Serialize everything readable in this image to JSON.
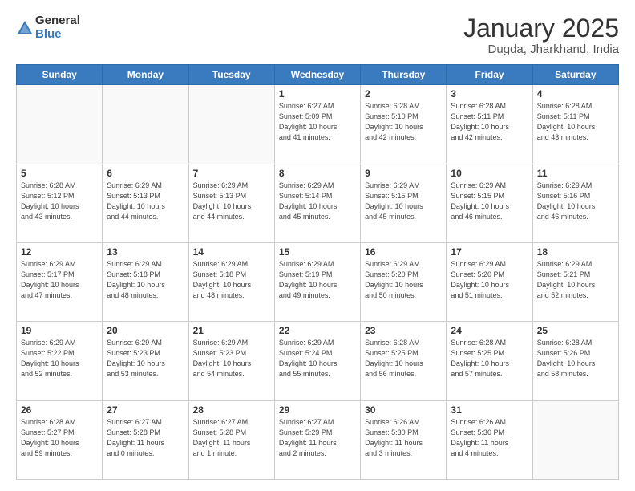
{
  "header": {
    "logo_general": "General",
    "logo_blue": "Blue",
    "month_title": "January 2025",
    "location": "Dugda, Jharkhand, India"
  },
  "days_of_week": [
    "Sunday",
    "Monday",
    "Tuesday",
    "Wednesday",
    "Thursday",
    "Friday",
    "Saturday"
  ],
  "weeks": [
    [
      {
        "day": "",
        "info": ""
      },
      {
        "day": "",
        "info": ""
      },
      {
        "day": "",
        "info": ""
      },
      {
        "day": "1",
        "info": "Sunrise: 6:27 AM\nSunset: 5:09 PM\nDaylight: 10 hours\nand 41 minutes."
      },
      {
        "day": "2",
        "info": "Sunrise: 6:28 AM\nSunset: 5:10 PM\nDaylight: 10 hours\nand 42 minutes."
      },
      {
        "day": "3",
        "info": "Sunrise: 6:28 AM\nSunset: 5:11 PM\nDaylight: 10 hours\nand 42 minutes."
      },
      {
        "day": "4",
        "info": "Sunrise: 6:28 AM\nSunset: 5:11 PM\nDaylight: 10 hours\nand 43 minutes."
      }
    ],
    [
      {
        "day": "5",
        "info": "Sunrise: 6:28 AM\nSunset: 5:12 PM\nDaylight: 10 hours\nand 43 minutes."
      },
      {
        "day": "6",
        "info": "Sunrise: 6:29 AM\nSunset: 5:13 PM\nDaylight: 10 hours\nand 44 minutes."
      },
      {
        "day": "7",
        "info": "Sunrise: 6:29 AM\nSunset: 5:13 PM\nDaylight: 10 hours\nand 44 minutes."
      },
      {
        "day": "8",
        "info": "Sunrise: 6:29 AM\nSunset: 5:14 PM\nDaylight: 10 hours\nand 45 minutes."
      },
      {
        "day": "9",
        "info": "Sunrise: 6:29 AM\nSunset: 5:15 PM\nDaylight: 10 hours\nand 45 minutes."
      },
      {
        "day": "10",
        "info": "Sunrise: 6:29 AM\nSunset: 5:15 PM\nDaylight: 10 hours\nand 46 minutes."
      },
      {
        "day": "11",
        "info": "Sunrise: 6:29 AM\nSunset: 5:16 PM\nDaylight: 10 hours\nand 46 minutes."
      }
    ],
    [
      {
        "day": "12",
        "info": "Sunrise: 6:29 AM\nSunset: 5:17 PM\nDaylight: 10 hours\nand 47 minutes."
      },
      {
        "day": "13",
        "info": "Sunrise: 6:29 AM\nSunset: 5:18 PM\nDaylight: 10 hours\nand 48 minutes."
      },
      {
        "day": "14",
        "info": "Sunrise: 6:29 AM\nSunset: 5:18 PM\nDaylight: 10 hours\nand 48 minutes."
      },
      {
        "day": "15",
        "info": "Sunrise: 6:29 AM\nSunset: 5:19 PM\nDaylight: 10 hours\nand 49 minutes."
      },
      {
        "day": "16",
        "info": "Sunrise: 6:29 AM\nSunset: 5:20 PM\nDaylight: 10 hours\nand 50 minutes."
      },
      {
        "day": "17",
        "info": "Sunrise: 6:29 AM\nSunset: 5:20 PM\nDaylight: 10 hours\nand 51 minutes."
      },
      {
        "day": "18",
        "info": "Sunrise: 6:29 AM\nSunset: 5:21 PM\nDaylight: 10 hours\nand 52 minutes."
      }
    ],
    [
      {
        "day": "19",
        "info": "Sunrise: 6:29 AM\nSunset: 5:22 PM\nDaylight: 10 hours\nand 52 minutes."
      },
      {
        "day": "20",
        "info": "Sunrise: 6:29 AM\nSunset: 5:23 PM\nDaylight: 10 hours\nand 53 minutes."
      },
      {
        "day": "21",
        "info": "Sunrise: 6:29 AM\nSunset: 5:23 PM\nDaylight: 10 hours\nand 54 minutes."
      },
      {
        "day": "22",
        "info": "Sunrise: 6:29 AM\nSunset: 5:24 PM\nDaylight: 10 hours\nand 55 minutes."
      },
      {
        "day": "23",
        "info": "Sunrise: 6:28 AM\nSunset: 5:25 PM\nDaylight: 10 hours\nand 56 minutes."
      },
      {
        "day": "24",
        "info": "Sunrise: 6:28 AM\nSunset: 5:25 PM\nDaylight: 10 hours\nand 57 minutes."
      },
      {
        "day": "25",
        "info": "Sunrise: 6:28 AM\nSunset: 5:26 PM\nDaylight: 10 hours\nand 58 minutes."
      }
    ],
    [
      {
        "day": "26",
        "info": "Sunrise: 6:28 AM\nSunset: 5:27 PM\nDaylight: 10 hours\nand 59 minutes."
      },
      {
        "day": "27",
        "info": "Sunrise: 6:27 AM\nSunset: 5:28 PM\nDaylight: 11 hours\nand 0 minutes."
      },
      {
        "day": "28",
        "info": "Sunrise: 6:27 AM\nSunset: 5:28 PM\nDaylight: 11 hours\nand 1 minute."
      },
      {
        "day": "29",
        "info": "Sunrise: 6:27 AM\nSunset: 5:29 PM\nDaylight: 11 hours\nand 2 minutes."
      },
      {
        "day": "30",
        "info": "Sunrise: 6:26 AM\nSunset: 5:30 PM\nDaylight: 11 hours\nand 3 minutes."
      },
      {
        "day": "31",
        "info": "Sunrise: 6:26 AM\nSunset: 5:30 PM\nDaylight: 11 hours\nand 4 minutes."
      },
      {
        "day": "",
        "info": ""
      }
    ]
  ]
}
